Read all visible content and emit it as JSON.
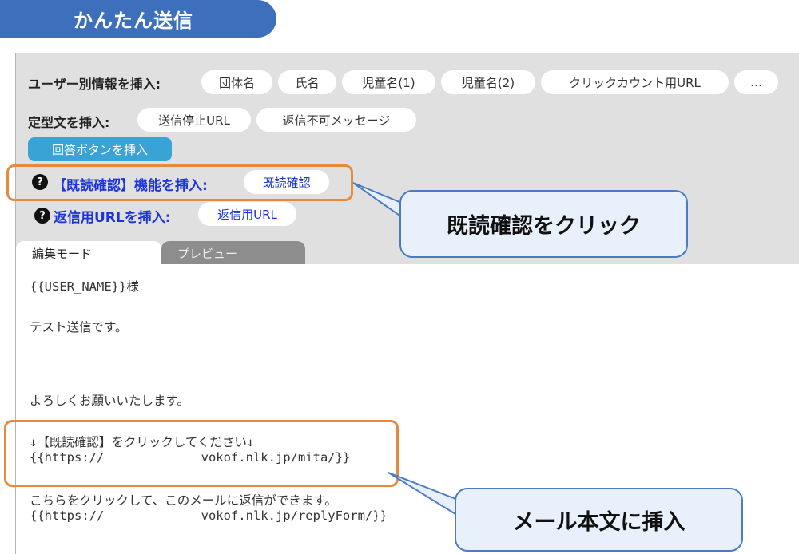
{
  "header": {
    "title": "かんたん送信"
  },
  "toolbar": {
    "user_info_label": "ユーザー別情報を挿入:",
    "user_info_chips": [
      "団体名",
      "氏名",
      "児童名(1)",
      "児童名(2)",
      "クリックカウント用URL",
      "…"
    ],
    "template_label": "定型文を挿入:",
    "template_chips": [
      "送信停止URL",
      "返信不可メッセージ"
    ],
    "answer_button": "回答ボタンを挿入",
    "read_confirm_label": "【既読確認】機能を挿入:",
    "read_confirm_chip": "既読確認",
    "reply_url_label": "返信用URLを挿入:",
    "reply_url_chip": "返信用URL",
    "help_glyph": "?"
  },
  "tabs": {
    "edit": "編集モード",
    "preview": "プレビュー"
  },
  "editor": {
    "lines": [
      "{{USER_NAME}}様",
      "テスト送信です。",
      "よろしくお願いいたします。",
      "↓【既読確認】をクリックしてください↓",
      "{{https://             vokof.nlk.jp/mita/}}",
      "こちらをクリックして、このメールに返信ができます。",
      "{{https://             vokof.nlk.jp/replyForm/}}"
    ]
  },
  "callouts": {
    "click_read_confirm": "既読確認をクリック",
    "insert_into_body": "メール本文に挿入"
  },
  "colors": {
    "header_blue": "#3d6fbd",
    "answer_button": "#3aa3d6",
    "highlight_orange": "#e88a3e",
    "label_blue": "#1d34d8",
    "callout_border": "#4a7cc4"
  }
}
